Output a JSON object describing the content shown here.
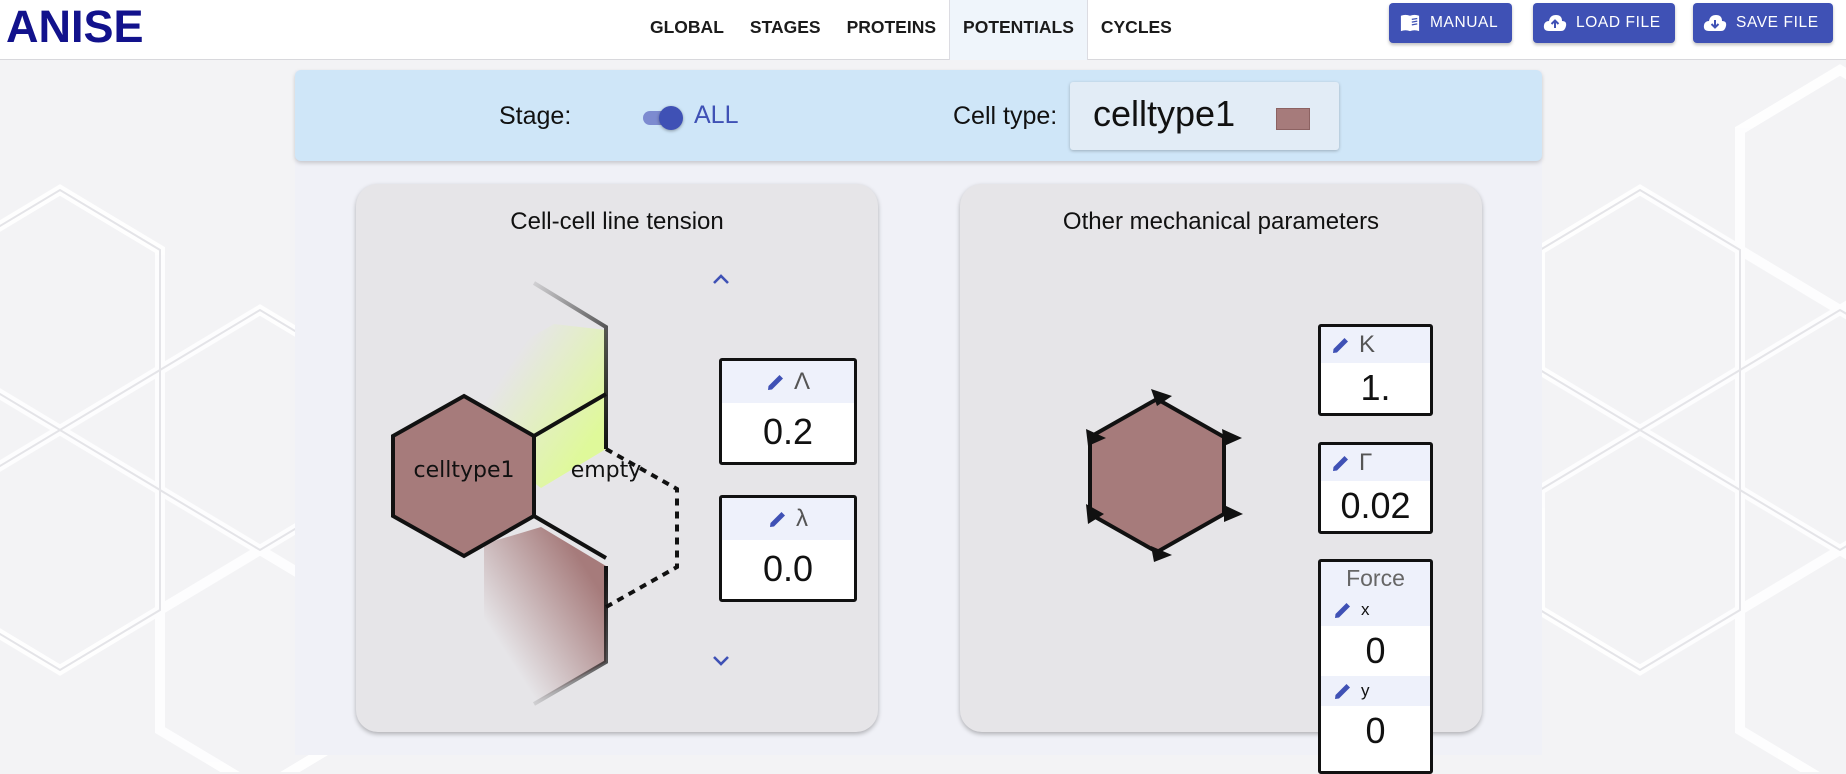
{
  "app": {
    "brand": "ANISE"
  },
  "nav": {
    "tabs": [
      {
        "label": "GLOBAL"
      },
      {
        "label": "STAGES"
      },
      {
        "label": "PROTEINS"
      },
      {
        "label": "POTENTIALS",
        "active": true
      },
      {
        "label": "CYCLES"
      }
    ]
  },
  "toolbar": {
    "manual_label": "MANUAL",
    "load_label": "LOAD FILE",
    "save_label": "SAVE FILE"
  },
  "stagebar": {
    "stage_label": "Stage:",
    "stage_value": "ALL",
    "stage_toggle_on": true,
    "celltype_label": "Cell type:",
    "celltype_value": "celltype1",
    "celltype_color": "#a67b7b"
  },
  "tension_card": {
    "title": "Cell-cell line tension",
    "cell_label": "celltype1",
    "neighbor_label": "empty",
    "params": [
      {
        "symbol": "Λ",
        "value": "0.2"
      },
      {
        "symbol": "λ",
        "value": "0.0"
      }
    ]
  },
  "mech_card": {
    "title": "Other mechanical parameters",
    "K": {
      "symbol": "K",
      "value": "1."
    },
    "Gamma": {
      "symbol": "Γ",
      "value": "0.02"
    },
    "force": {
      "title": "Force",
      "x_label": "x",
      "x_value": "0",
      "y_label": "y",
      "y_value": "0"
    }
  },
  "colors": {
    "accent": "#3f51b5",
    "brand": "#12128c",
    "celltype1": "#a67b7b",
    "neighbor_highlight": "#dff99a"
  }
}
